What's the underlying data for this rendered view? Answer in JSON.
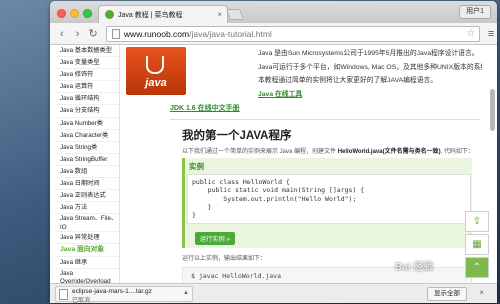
{
  "browser": {
    "tab_title": "Java 教程 | 菜鸟教程",
    "tab_close": "×",
    "user_button": "用户1",
    "back_icon": "‹",
    "forward_icon": "›",
    "reload_icon": "↻",
    "url_host": "www.runoob.com",
    "url_path": "/java/java-tutorial.html",
    "star_icon": "☆",
    "menu_icon": "≡"
  },
  "sidebar": {
    "items": [
      "Java 基本数据类型",
      "Java 变量类型",
      "Java 修饰符",
      "Java 运算符",
      "Java 循环结构",
      "Java 分支结构",
      "Java Number类",
      "Java Character类",
      "Java String类",
      "Java StringBuffer",
      "Java 数组",
      "Java 日期时间",
      "Java 正则表达式",
      "Java 方法",
      "Java Stream、File、IO",
      "Java 异常处理"
    ],
    "section": "Java 面向对象",
    "section_items": [
      "Java 继承",
      "Java Override/Overload"
    ]
  },
  "main": {
    "logo_text": "java",
    "intro": [
      "Java 是由Sun Microsystems公司于1995年5月推出的Java程序设计语言。",
      "Java可运行于多个平台，如Windows, Mac OS，及其他多种UNIX版本的系统。",
      "本教程通过简单的实例将让大家更好的了解JAVA编程语言。"
    ],
    "online_tool": "Java 在线工具",
    "jdk_link": "JDK 1.6 在线中文手册",
    "heading": "我的第一个JAVA程序",
    "desc_prefix": "以下我们通过一个简单的实例来展示 Java 编程，创建文件 ",
    "desc_bold": "HelloWorld.java(文件名需与类名一致)",
    "desc_suffix": ", 代码如下：",
    "example_label": "实例",
    "code": [
      "public class HelloWorld {",
      "    public static void main(String []args) {",
      "        System.out.println(\"Hello World\");",
      "    }",
      "}"
    ],
    "run_button": "运行实例 »",
    "run_text": "运行以上实例，输出结果如下：",
    "terminal_line": "$ javac HelloWorld.java"
  },
  "float_tools": {
    "share_icon": "⇪",
    "qr_icon": "▦",
    "top_icon": "⌃"
  },
  "downloads": {
    "file_name": "eclipse-java-mars-1....tar.gz",
    "status": "已取消",
    "caret": "▲",
    "show_all": "显示全部",
    "close": "×"
  },
  "watermark": "Bai 经验"
}
